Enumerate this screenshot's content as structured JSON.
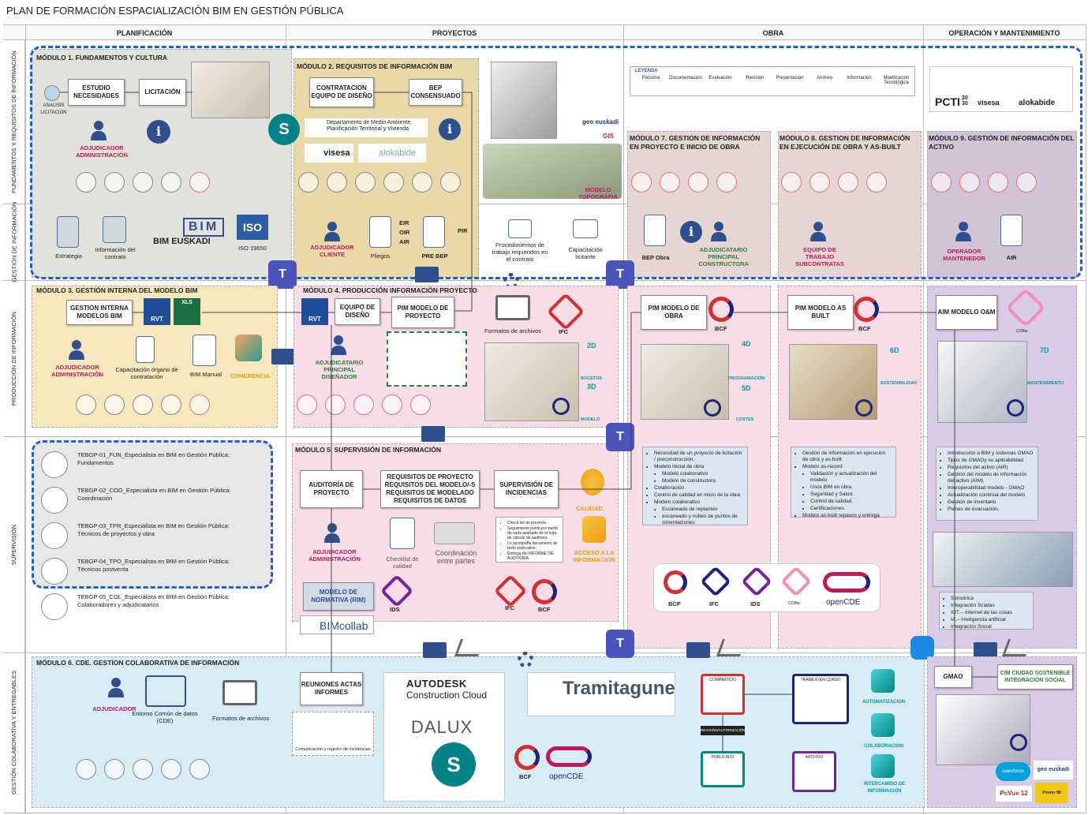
{
  "title": "PLAN DE FORMACIÓN ESPACIALIZACIÓN BIM EN GESTIÓN PÚBLICA",
  "columns": [
    "PLANIFICACIÓN",
    "PROYECTOS",
    "OBRA",
    "OPERACIÓN Y MANTENIMIENTO"
  ],
  "rows": [
    "FUNDAMENTOS Y REQUISITOS DE INFORMACIÓN",
    "GESTIÓN DE INFORMACIÓN",
    "PRODUCCIÓN DE INFORMACIÓN",
    "SUPERVISIÓN",
    "GESTIÓN COLABORATIVA Y ENTREGABLES"
  ],
  "m1": {
    "title": "MÓDULO 1.  FUNDAMENTOS Y CULTURA",
    "analisis": "ANALISIS LICITACION",
    "estudio": "ESTUDIO NECESIDADES",
    "licitacion": "LICITACIÓN",
    "adjudicador": "ADJUDICADOR ADMINISTRACIÓN",
    "estrategia": "Estrategia",
    "info_contrato": "Información del contrato",
    "bim_euskadi": "BIM EUSKADI",
    "bim": "BIM",
    "iso": "ISO",
    "iso_num": "ISO 19650"
  },
  "m2": {
    "title": "MÓDULO 2. REQUISITOS DE INFORMACIÓN BIM",
    "contratacion": "CONTRATACION EQUIPO DE DISEÑO",
    "bep": "BEP CONSENSUADO",
    "departamento": "Departamento de Medio Ambiente, Planificación Territorial y Vivienda",
    "visesa": "visesa",
    "alokabide": "alokabide",
    "adjudicador_cliente": "ADJUDICADOR CLIENTE",
    "pliegos": "Pliegos",
    "eir": "EIR",
    "oir": "OIR",
    "air": "AIR",
    "pir": "PIR",
    "pre_bep": "PRE BEP",
    "procedimientos": "Procedimientos de trabajo requeridos en el contrato",
    "capacitacion": "Capacitación licitante",
    "geo_euskadi": "geo euskadi",
    "gis": "GIS",
    "modelo_topografia": "MODELO TOPOGRAFIA"
  },
  "legend": {
    "title": "LEYENDA",
    "items": [
      "Persona",
      "Documentación",
      "Evaluación",
      "Revisión",
      "Presentación",
      "Archivo",
      "Información",
      "Movilización Tecnológica"
    ]
  },
  "pcti": "PCTI",
  "pcti_year": "20 30",
  "pcti_visesa": "visesa",
  "pcti_alokabide": "alokabide",
  "m7": {
    "title": "MÓDULO 7. GESTION DE INFORMACIÓN EN PROYECTO E INICIO DE OBRA",
    "bep_obra": "BEP Obra",
    "adjudicatario": "ADJUDICATARIO PRINCIPAL CONSTRUCTORA",
    "pim": "PIM MODELO DE OBRA",
    "bcf": "BCF",
    "d4": "4D",
    "programacion": "PROGRAMACIÓN",
    "d5": "5D",
    "costes": "COSTES",
    "bullets": [
      "Necesidad de un proyecto de licitación / preconstrucción.",
      "Modelo inicial de obra",
      "Modelo colaborativo",
      "Modelo de constructora",
      "Colaboración",
      "Control de calidad en inicio de la obra:",
      "Modelo colaborativo",
      "Escaneado de replanteo",
      "escaneado y nubes de puntos de cimentaciones"
    ]
  },
  "m8": {
    "title": "MÓDULO 8. GESTION DE INFORMACIÓN EN EJECUCIÓN DE OBRA Y AS-BUILT",
    "equipo": "EQUIPO DE TRABAJO SUBCONTRATAS",
    "pim": "PIM MODELO AS BUILT",
    "bcf": "BCF",
    "d6": "6D",
    "sostenibilidad": "SOSTENIBILIDAD",
    "bullets": [
      "Gestión de información en ejecución de obra y as-built",
      "Modelo as-record",
      "Validación y actualización del modelo",
      "Usos BIM en obra.",
      "Seguridad y Salud.",
      "Control de calidad.",
      "Certificaciones.",
      "Modelo as-built repasos y entrega"
    ]
  },
  "m9": {
    "title": "MÓDULO 9. GESTIÓN DE INFORMACIÓN DEL ACTIVO",
    "operador": "OPERADOR MANTENEDOR",
    "air": "AIR",
    "aim": "AIM MODELO O&M",
    "cobie": "COBie",
    "d7": "7D",
    "mantenimiento": "MANTENIMIENTO",
    "bullets": [
      "Introducción a BIM y sistemas GMAO",
      "Tipos de GMAOy su aplicabilidad",
      "Requisitos del activo (AIR)",
      "Gestión del modelo de información del activo (AIM)",
      "Interoperabilidad modelo - GMAO",
      "Actualización continua del modelo",
      "Gestión de inventario",
      "Planes de evacuación."
    ],
    "bullets2": [
      "Sensórica",
      "Integración Scadas",
      "IOT – Internet de las cosas",
      "IA – Inteligencia artificial",
      "Integración Social"
    ]
  },
  "m3": {
    "title": "MÓDULO 3. GESTIÓN INTERNA DEL MODELO BIM",
    "gestion": "GESTION INTERNA MODELOS BIM",
    "rvt": "RVT",
    "xls": "XLS",
    "adjudicador": "ADJUDICADOR ADMINISTRACIÓN",
    "capacitacion": "Capacitación órgano de contratación",
    "manual": "BIM Manual",
    "coherencia": "COHERENCIA"
  },
  "m4": {
    "title": "MÓDULO 4. PRODUCCIÓN INFORMACIÓN PROYECTO",
    "rvt": "RVT",
    "equipo": "EQUIPO DE DISEÑO",
    "pim": "PIM MODELO DE PROYECTO",
    "formatos": "Formatos de archivos",
    "ifc": "IFC",
    "adjudicatario": "ADJUDICATARIO PRINCIPAL DISEÑADOR",
    "d2": "2D",
    "bocetos": "BOCETOS",
    "d3": "3D",
    "modelo": "MODELO"
  },
  "m5": {
    "title": "MÓDULO 5. SUPERVISIÓN DE INFORMACIÓN",
    "auditoria": "AUDITORÍA DE PROYECTO",
    "requisitos": "REQUISITOS DE PROYECTO REQUISITOS DEL MODELO/-S REQUISITOS DE MODELADO REQUISITOS DE DATOS",
    "supervision": "SUPERVISIÓN DE INCIDENCIAS",
    "calidad": "CALIDAD",
    "adjudicador": "ADJUDICADOR ADMINISTRACIÓN",
    "checklist": "Checklist de calidad",
    "coordinacion": "Coordinación entre partes",
    "acceso": "ACCESO A LA INFORMACION",
    "bullets": [
      "Check-list de proyecto.",
      "Seguimiento punto por punto de cada apartado de la hoja de cálculo de auditoría.",
      "Lo acompaña documento de texto explicativo.",
      "Entrega del INFORME DE AUDITORÍA"
    ],
    "modelo_normativa": "MODELO DE NORMATIVA (RIM)",
    "ids": "IDS",
    "ifc": "IFC",
    "bcf": "BCF",
    "bimcollab": "BIMcollab"
  },
  "openbim": [
    "BCF",
    "IFC",
    "IDS",
    "COBie",
    "openCDE"
  ],
  "supervision_list": [
    {
      "code": "TEBGP-01_FUN_Especialista en BIM en Gestión Pública:",
      "sub": "Fundamentos"
    },
    {
      "code": "TEBGP-02_COO_Especialista en BIM en Gestión Pública:",
      "sub": "Coordinación"
    },
    {
      "code": "TEBGP-03_TPR_Especialista en BIM en Gestión Pública:",
      "sub": "Técnicos de proyectos y obra"
    },
    {
      "code": "TEBGP-04_TPO_Especialista en BIM en Gestión Pública:",
      "sub": "Técnicos postventa"
    },
    {
      "code": "TEBGP-05_COL_Especialista en BIM en Gestión Pública:",
      "sub": "Colaboradores y adjudicatarios"
    }
  ],
  "m6": {
    "title": "MÓDULO 6. CDE. GESTION COLABORATIVA DE INFORMACIÓN",
    "adjudicador": "ADJUDICADOR",
    "entorno": "Entorno Común de datos (CDE)",
    "formatos": "Formatos de archivos",
    "reuniones": "REUNIONES ACTAS INFORMES",
    "comunicacion": "Comunicación y registro de incidencias",
    "autodesk": "AUTODESK",
    "construction": "Construction Cloud",
    "dalux": "DALUX",
    "tramitagune": "Tramitagune",
    "bcf": "BCF",
    "opencde": "openCDE",
    "compartido": "COMPARTIDO",
    "trabajo": "TRABAJO EN CURSO",
    "revision": "REVISIÓN/AUTORIZACIÓN",
    "publicado": "PUBLICADO",
    "archivo": "ARCHIVO",
    "automatizacion": "AUTOMATIZACION",
    "colaboracion": "COLABORACION",
    "intercambio": "INTERCAMBIO DE INFORMACIÓN",
    "gmao": "GMAO",
    "cim": "CIM CIUDAD SOSTENIBLE INTEGRACION SOCIAL",
    "salesforce": "salesforce",
    "geo": "geo euskadi",
    "pcvue": "PcVue 12",
    "powerbi": "Power BI"
  },
  "colors": {
    "pink": "#c2185b",
    "green": "#2e7d32",
    "blue_dash": "#1e5fd6",
    "gold": "#e9d9a8",
    "grey": "#e2e2dc",
    "rose": "#f6dde8",
    "lilac": "#d9cbe6",
    "cyan": "#d7ecf5"
  }
}
